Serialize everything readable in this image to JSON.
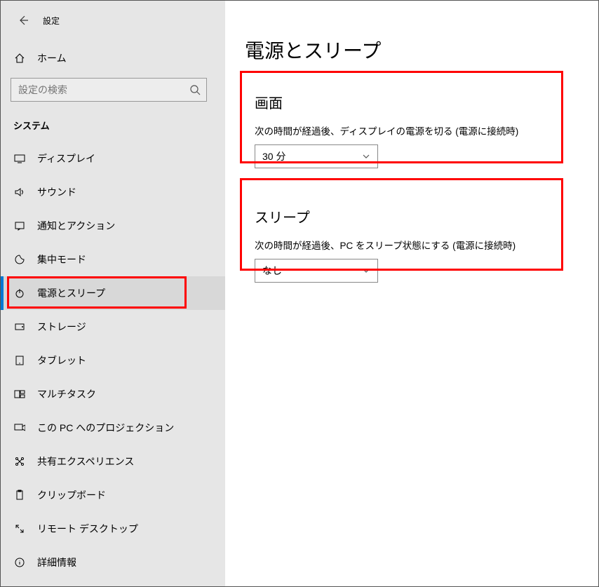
{
  "header": {
    "window_title": "設定"
  },
  "home": {
    "label": "ホーム"
  },
  "search": {
    "placeholder": "設定の検索"
  },
  "category": "システム",
  "nav": [
    {
      "icon": "display-icon",
      "label": "ディスプレイ"
    },
    {
      "icon": "sound-icon",
      "label": "サウンド"
    },
    {
      "icon": "notification-icon",
      "label": "通知とアクション"
    },
    {
      "icon": "focus-icon",
      "label": "集中モード"
    },
    {
      "icon": "power-icon",
      "label": "電源とスリープ",
      "selected": true
    },
    {
      "icon": "storage-icon",
      "label": "ストレージ"
    },
    {
      "icon": "tablet-icon",
      "label": "タブレット"
    },
    {
      "icon": "multitask-icon",
      "label": "マルチタスク"
    },
    {
      "icon": "projection-icon",
      "label": "この PC へのプロジェクション"
    },
    {
      "icon": "shared-icon",
      "label": "共有エクスペリエンス"
    },
    {
      "icon": "clipboard-icon",
      "label": "クリップボード"
    },
    {
      "icon": "remote-icon",
      "label": "リモート デスクトップ"
    },
    {
      "icon": "info-icon",
      "label": "詳細情報"
    }
  ],
  "page": {
    "title": "電源とスリープ",
    "screen": {
      "heading": "画面",
      "label": "次の時間が経過後、ディスプレイの電源を切る (電源に接続時)",
      "value": "30 分"
    },
    "sleep": {
      "heading": "スリープ",
      "label": "次の時間が経過後、PC をスリープ状態にする (電源に接続時)",
      "value": "なし"
    }
  }
}
